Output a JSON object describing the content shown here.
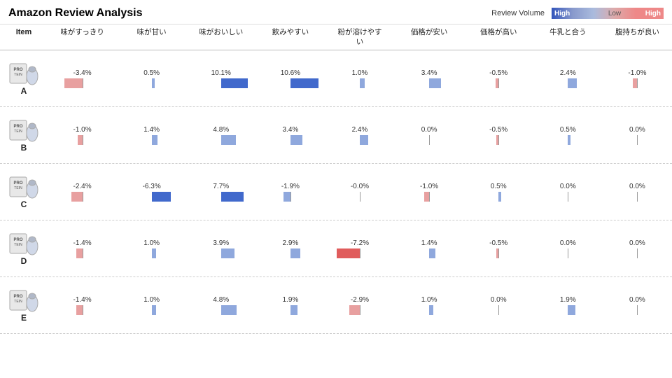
{
  "app": {
    "title": "Amazon Review Analysis"
  },
  "legend": {
    "label": "Review Volume",
    "high_left": "High",
    "low": "Low",
    "high_right": "High"
  },
  "columns": [
    "Item",
    "味がすっきり",
    "味が甘い",
    "味がおいしい",
    "飲みやすい",
    "粉が溶けやすい",
    "価格が安い",
    "価格が高い",
    "牛乳と合う",
    "腹持ちが良い"
  ],
  "rows": [
    {
      "label": "A",
      "cells": [
        {
          "top": "-3.4%",
          "bot": null,
          "bar_top": {
            "val": -3.4,
            "color": "red-light"
          },
          "bar_bot": null
        },
        {
          "top": "0.5%",
          "bot": null,
          "bar_top": {
            "val": 0.5,
            "color": "blue-light"
          },
          "bar_bot": null
        },
        {
          "top": "10.1%",
          "bot": null,
          "bar_top": {
            "val": 10.1,
            "color": "blue-strong"
          },
          "bar_bot": null
        },
        {
          "top": "10.6%",
          "bot": null,
          "bar_top": {
            "val": 10.6,
            "color": "blue-strong"
          },
          "bar_bot": null
        },
        {
          "top": "1.0%",
          "bot": null,
          "bar_top": {
            "val": 1.0,
            "color": "blue-light"
          },
          "bar_bot": null
        },
        {
          "top": "3.4%",
          "bot": null,
          "bar_top": {
            "val": 3.4,
            "color": "blue-light"
          },
          "bar_bot": null
        },
        {
          "top": "-0.5%",
          "bot": null,
          "bar_top": {
            "val": -0.5,
            "color": "red-light"
          },
          "bar_bot": null
        },
        {
          "top": "2.4%",
          "bot": null,
          "bar_top": {
            "val": 2.4,
            "color": "blue-light"
          },
          "bar_bot": null
        },
        {
          "top": "-1.0%",
          "bot": null,
          "bar_top": {
            "val": -1.0,
            "color": "red-light"
          },
          "bar_bot": null
        }
      ]
    },
    {
      "label": "B",
      "cells": [
        {
          "top": "-1.0%",
          "bot": null,
          "bar_top": {
            "val": -1.0,
            "color": "red-light"
          },
          "bar_bot": null
        },
        {
          "top": "1.4%",
          "bot": null,
          "bar_top": {
            "val": 1.4,
            "color": "blue-light"
          },
          "bar_bot": null
        },
        {
          "top": "4.8%",
          "bot": null,
          "bar_top": {
            "val": 4.8,
            "color": "blue-light"
          },
          "bar_bot": null
        },
        {
          "top": "3.4%",
          "bot": null,
          "bar_top": {
            "val": 3.4,
            "color": "blue-light"
          },
          "bar_bot": null
        },
        {
          "top": "2.4%",
          "bot": null,
          "bar_top": {
            "val": 2.4,
            "color": "blue-light"
          },
          "bar_bot": null
        },
        {
          "top": "0.0%",
          "bot": null,
          "bar_top": {
            "val": 0.0,
            "color": "blue-light"
          },
          "bar_bot": null
        },
        {
          "top": "-0.5%",
          "bot": null,
          "bar_top": {
            "val": -0.5,
            "color": "red-light"
          },
          "bar_bot": null
        },
        {
          "top": "0.5%",
          "bot": null,
          "bar_top": {
            "val": 0.5,
            "color": "blue-light"
          },
          "bar_bot": null
        },
        {
          "top": "0.0%",
          "bot": null,
          "bar_top": {
            "val": 0.0,
            "color": "blue-light"
          },
          "bar_bot": null
        }
      ]
    },
    {
      "label": "C",
      "cells": [
        {
          "top": "-2.4%",
          "bot": null,
          "bar_top": {
            "val": -2.4,
            "color": "red-light"
          },
          "bar_bot": null
        },
        {
          "top": "-6.3%",
          "bot": null,
          "bar_top": {
            "val": -6.3,
            "color": "blue-strong"
          },
          "bar_bot": null
        },
        {
          "top": "7.7%",
          "bot": null,
          "bar_top": {
            "val": 7.7,
            "color": "blue-strong"
          },
          "bar_bot": null
        },
        {
          "top": "-1.9%",
          "bot": null,
          "bar_top": {
            "val": -1.9,
            "color": "blue-light"
          },
          "bar_bot": null
        },
        {
          "top": "-0.0%",
          "bot": null,
          "bar_top": {
            "val": 0.0,
            "color": "blue-light"
          },
          "bar_bot": null
        },
        {
          "top": "-1.0%",
          "bot": null,
          "bar_top": {
            "val": -1.0,
            "color": "red-light"
          },
          "bar_bot": null
        },
        {
          "top": "0.5%",
          "bot": null,
          "bar_top": {
            "val": 0.5,
            "color": "blue-light"
          },
          "bar_bot": null
        },
        {
          "top": "0.0%",
          "bot": null,
          "bar_top": {
            "val": 0.0,
            "color": "blue-light"
          },
          "bar_bot": null
        },
        {
          "top": "0.0%",
          "bot": null,
          "bar_top": {
            "val": 0.0,
            "color": "blue-light"
          },
          "bar_bot": null
        }
      ]
    },
    {
      "label": "D",
      "cells": [
        {
          "top": "-1.4%",
          "bot": null,
          "bar_top": {
            "val": -1.4,
            "color": "red-light"
          },
          "bar_bot": null
        },
        {
          "top": "1.0%",
          "bot": null,
          "bar_top": {
            "val": 1.0,
            "color": "blue-light"
          },
          "bar_bot": null
        },
        {
          "top": "3.9%",
          "bot": null,
          "bar_top": {
            "val": 3.9,
            "color": "blue-light"
          },
          "bar_bot": null
        },
        {
          "top": "2.9%",
          "bot": null,
          "bar_top": {
            "val": 2.9,
            "color": "blue-light"
          },
          "bar_bot": null
        },
        {
          "top": "-7.2%",
          "bot": null,
          "bar_top": {
            "val": -7.2,
            "color": "red-strong"
          },
          "bar_bot": null
        },
        {
          "top": "1.4%",
          "bot": null,
          "bar_top": {
            "val": 1.4,
            "color": "blue-light"
          },
          "bar_bot": null
        },
        {
          "top": "-0.5%",
          "bot": null,
          "bar_top": {
            "val": -0.5,
            "color": "red-light"
          },
          "bar_bot": null
        },
        {
          "top": "0.0%",
          "bot": null,
          "bar_top": {
            "val": 0.0,
            "color": "blue-light"
          },
          "bar_bot": null
        },
        {
          "top": "0.0%",
          "bot": null,
          "bar_top": {
            "val": 0.0,
            "color": "blue-light"
          },
          "bar_bot": null
        }
      ]
    },
    {
      "label": "E",
      "cells": [
        {
          "top": "-1.4%",
          "bot": null,
          "bar_top": {
            "val": -1.4,
            "color": "red-light"
          },
          "bar_bot": null
        },
        {
          "top": "1.0%",
          "bot": null,
          "bar_top": {
            "val": 1.0,
            "color": "blue-light"
          },
          "bar_bot": null
        },
        {
          "top": "4.8%",
          "bot": null,
          "bar_top": {
            "val": 4.8,
            "color": "blue-light"
          },
          "bar_bot": null
        },
        {
          "top": "1.9%",
          "bot": null,
          "bar_top": {
            "val": 1.9,
            "color": "blue-light"
          },
          "bar_bot": null
        },
        {
          "top": "-2.9%",
          "bot": null,
          "bar_top": {
            "val": -2.9,
            "color": "red-light"
          },
          "bar_bot": null
        },
        {
          "top": "1.0%",
          "bot": null,
          "bar_top": {
            "val": 1.0,
            "color": "blue-light"
          },
          "bar_bot": null
        },
        {
          "top": "0.0%",
          "bot": null,
          "bar_top": {
            "val": 0.0,
            "color": "blue-light"
          },
          "bar_bot": null
        },
        {
          "top": "1.9%",
          "bot": null,
          "bar_top": {
            "val": 1.9,
            "color": "blue-light"
          },
          "bar_bot": null
        },
        {
          "top": "0.0%",
          "bot": null,
          "bar_top": {
            "val": 0.0,
            "color": "blue-light"
          },
          "bar_bot": null
        }
      ]
    }
  ],
  "colors": {
    "blue_strong": "#4169cc",
    "blue_light": "#8fa8dd",
    "red_strong": "#e05c5c",
    "red_light": "#e8a0a0",
    "legend_blue": "#6688cc",
    "legend_pink": "#e88888",
    "legend_high_left": "#5577cc",
    "legend_low": "#aabbdd",
    "legend_high_right": "#ee8888"
  }
}
